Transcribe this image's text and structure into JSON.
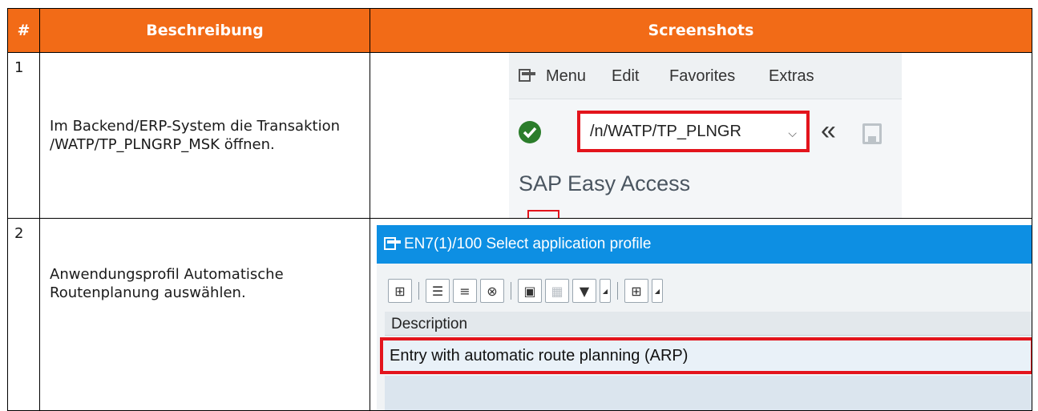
{
  "table": {
    "headers": {
      "num": "#",
      "description": "Beschreibung",
      "screenshots": "Screenshots"
    },
    "rows": [
      {
        "num": "1",
        "description": "Im Backend/ERP-System die Transaktion /WATP/TP_PLNGRP_MSK öffnen."
      },
      {
        "num": "2",
        "description": "Anwendungsprofil Automatische Routenplanung auswählen."
      }
    ]
  },
  "screenshot1": {
    "menu": [
      "Menu",
      "Edit",
      "Favorites",
      "Extras"
    ],
    "command_field": "/n/WATP/TP_PLNGR",
    "chevron": "⌵",
    "back_glyph": "«",
    "title": "SAP Easy Access"
  },
  "screenshot2": {
    "dialog_title": "EN7(1)/100 Select application profile",
    "column_header": "Description",
    "selected_row": "Entry with automatic route planning (ARP)",
    "toolbar_glyphs": [
      "⊞",
      "☰",
      "≡",
      "⊗",
      "▣",
      "▦",
      "▼",
      "◢",
      "⊞",
      "◢"
    ]
  },
  "colors": {
    "header_bg": "#f26b17",
    "highlight_red": "#e3141c",
    "sap_titlebar": "#0d8fe3"
  }
}
